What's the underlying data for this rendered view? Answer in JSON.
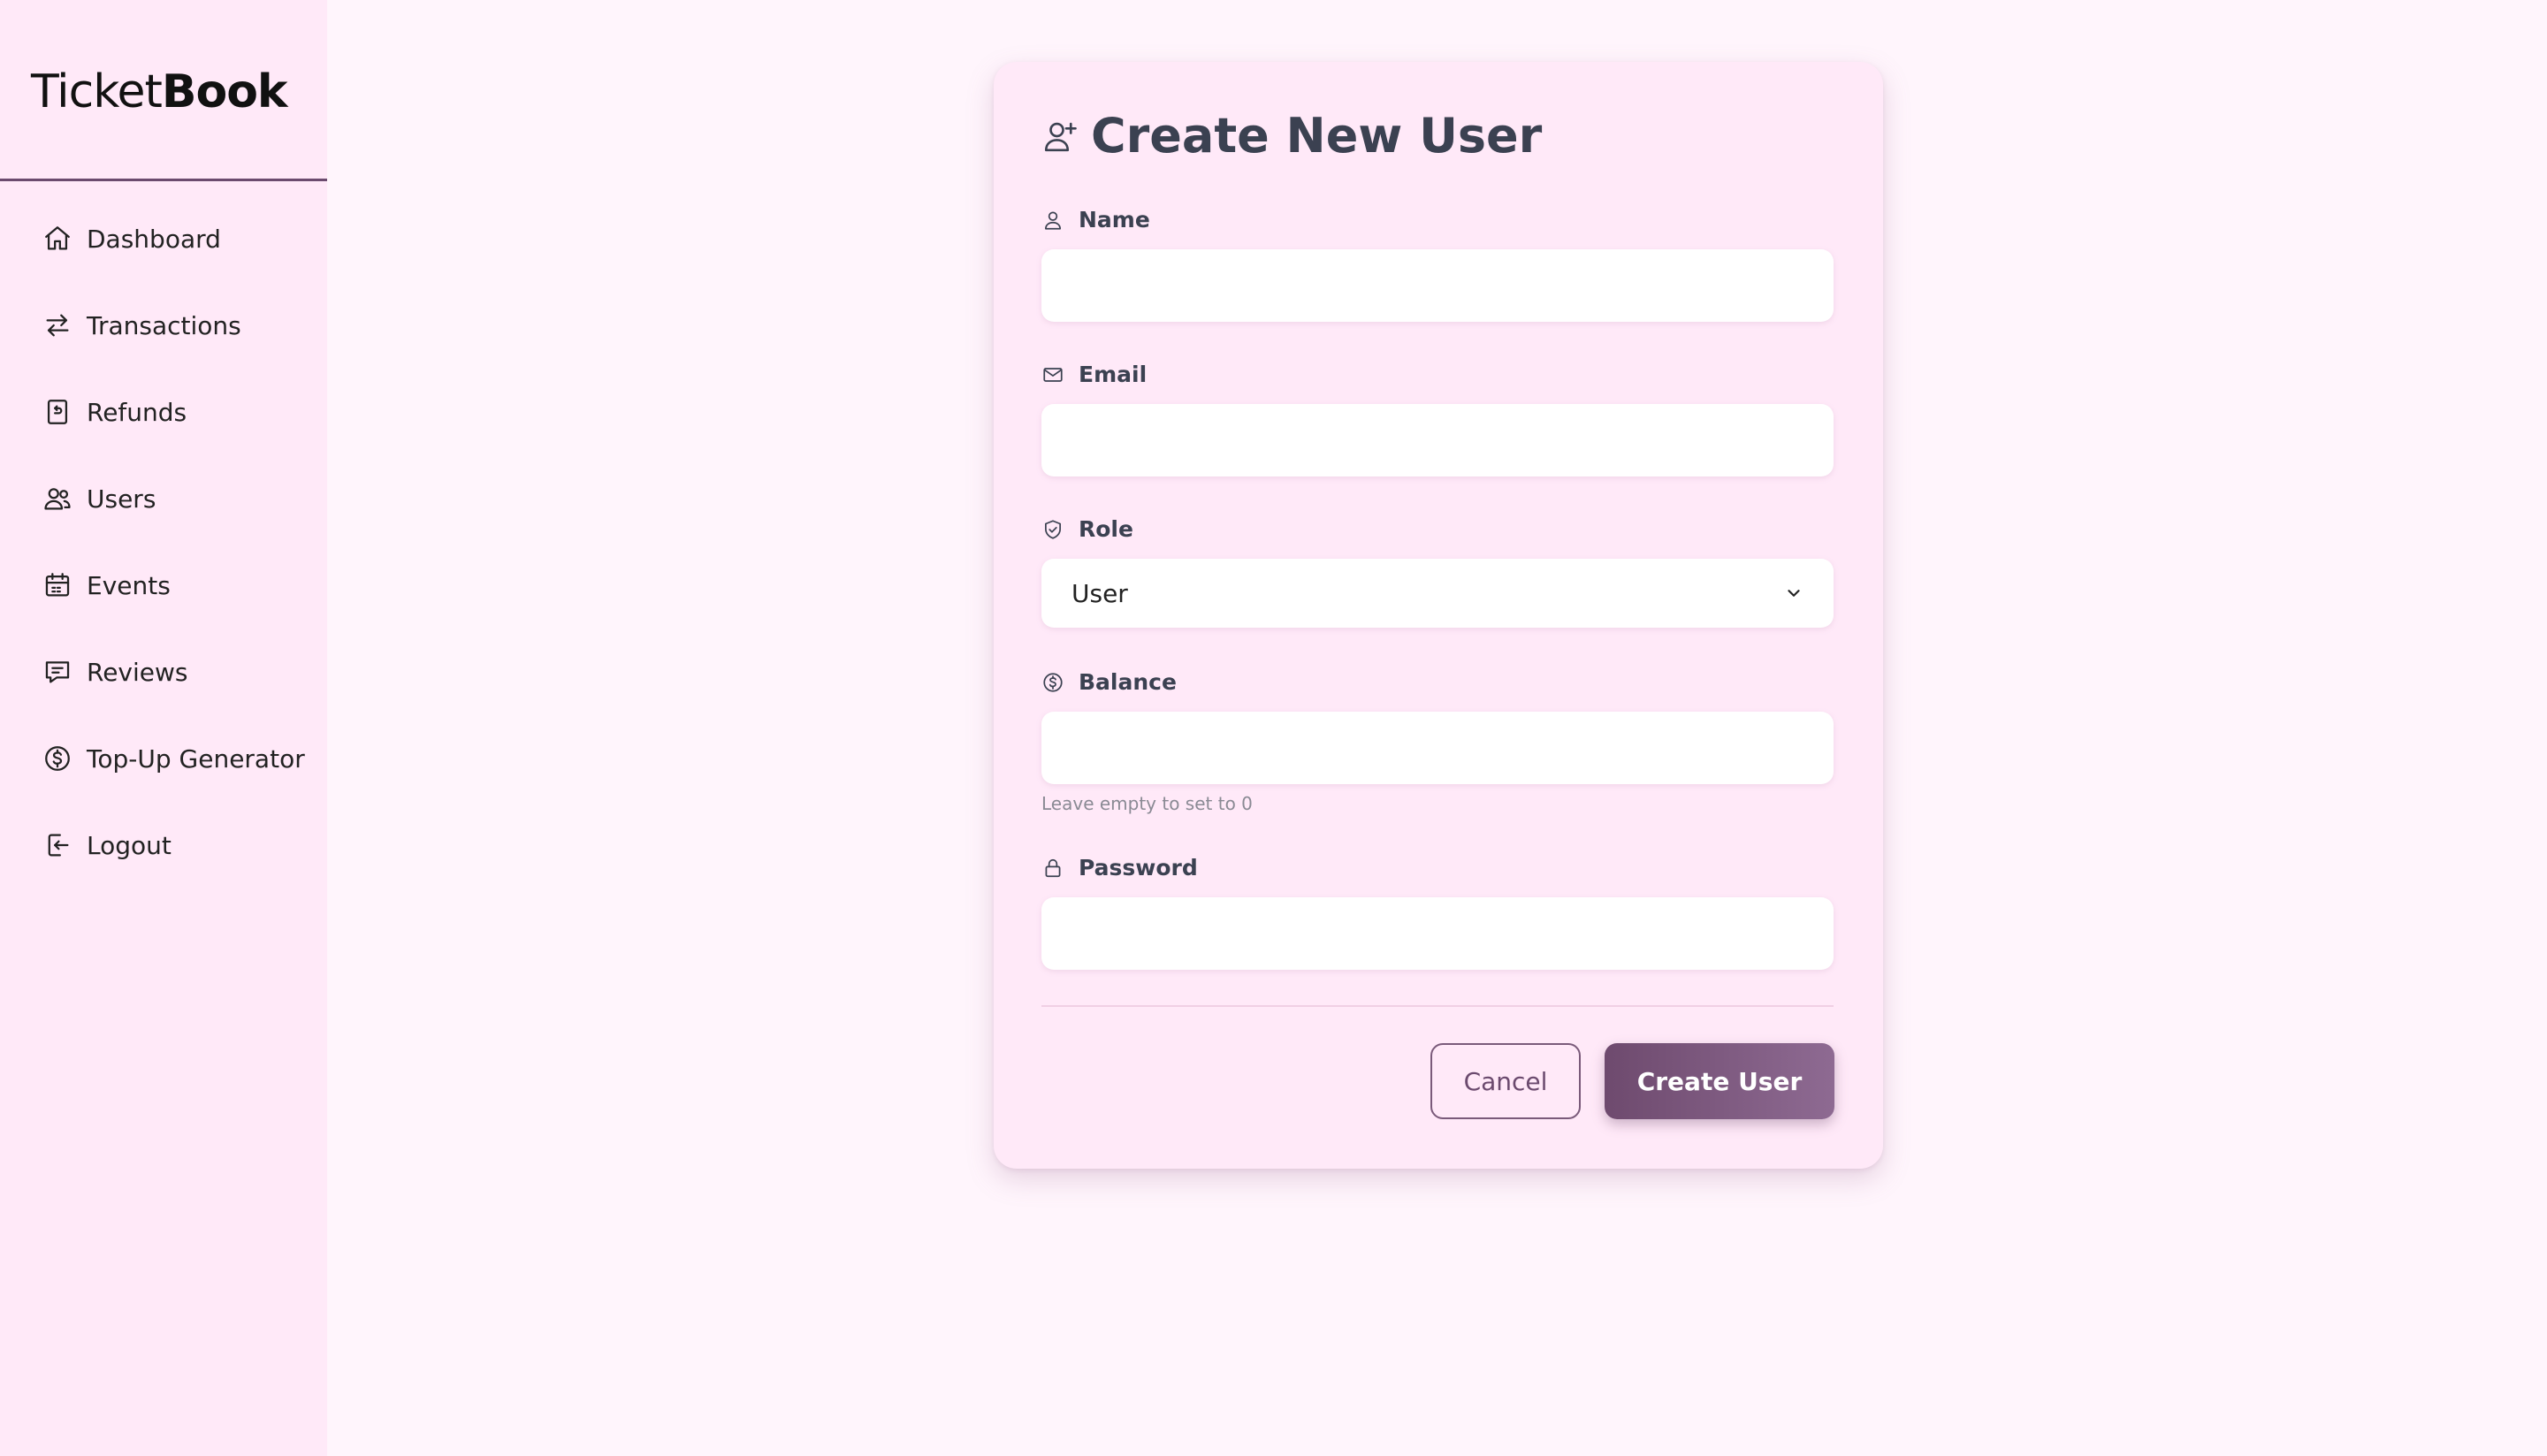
{
  "brand": {
    "light": "Ticket",
    "bold": "Book"
  },
  "sidebar": {
    "items": [
      {
        "label": "Dashboard",
        "icon": "home-icon"
      },
      {
        "label": "Transactions",
        "icon": "arrows-exchange-icon"
      },
      {
        "label": "Refunds",
        "icon": "receipt-refund-icon"
      },
      {
        "label": "Users",
        "icon": "users-icon"
      },
      {
        "label": "Events",
        "icon": "calendar-icon"
      },
      {
        "label": "Reviews",
        "icon": "message-icon"
      },
      {
        "label": "Top-Up Generator",
        "icon": "dollar-circle-icon"
      },
      {
        "label": "Logout",
        "icon": "logout-icon"
      }
    ]
  },
  "form": {
    "title": "Create New User",
    "title_icon": "user-plus-icon",
    "fields": {
      "name": {
        "label": "Name",
        "value": "",
        "placeholder": ""
      },
      "email": {
        "label": "Email",
        "value": "",
        "placeholder": ""
      },
      "role": {
        "label": "Role",
        "selected": "User"
      },
      "balance": {
        "label": "Balance",
        "value": "",
        "placeholder": "",
        "hint": "Leave empty to set to 0"
      },
      "password": {
        "label": "Password",
        "value": "",
        "placeholder": ""
      }
    },
    "cancel_label": "Cancel",
    "submit_label": "Create User"
  },
  "colors": {
    "page_bg": "#fff5fc",
    "sidebar_bg": "#ffe9f8",
    "card_bg": "#ffe9f8",
    "primary": "#6e4a6e",
    "primary_light": "#8e6a92",
    "text_dark": "#3b4151"
  }
}
